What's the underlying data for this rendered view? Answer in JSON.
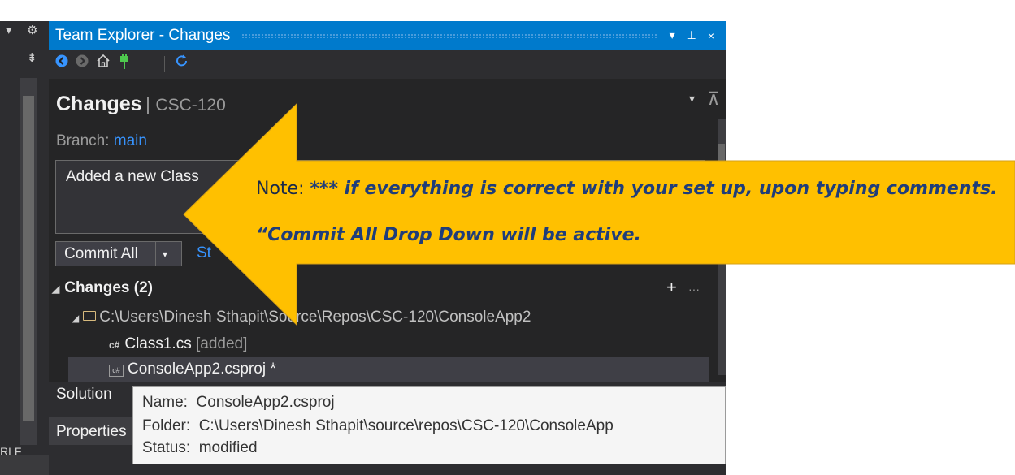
{
  "window": {
    "title": "Team Explorer - Changes",
    "title_buttons": [
      "▾",
      "⊥",
      "×"
    ]
  },
  "left_strip": {
    "line_ending": "RLF"
  },
  "toolbar": {
    "icons": [
      "back-icon",
      "forward-icon",
      "home-icon",
      "connect-icon",
      "refresh-icon"
    ]
  },
  "page": {
    "title": "Changes",
    "repo": "CSC-120",
    "branch_label": "Branch:",
    "branch_value": "main"
  },
  "comment": {
    "value": "Added a new Class"
  },
  "commit": {
    "label": "Commit All",
    "stash_label": "St"
  },
  "changes": {
    "header": "Changes (2)",
    "folder_path": "C:\\Users\\Dinesh Sthapit\\Source\\Repos\\CSC-120\\ConsoleApp2",
    "files": [
      {
        "name": "Class1.cs",
        "status": "[added]",
        "icon": "c#"
      },
      {
        "name": "ConsoleApp2.csproj *",
        "status": "",
        "icon": "c#"
      }
    ]
  },
  "tabs": {
    "solution": "Solution",
    "properties": "Properties"
  },
  "tooltip": {
    "name_label": "Name:",
    "name_value": "ConsoleApp2.csproj",
    "folder_label": "Folder:",
    "folder_value": "C:\\Users\\Dinesh Sthapit\\source\\repos\\CSC-120\\ConsoleApp",
    "status_label": "Status:",
    "status_value": "modified"
  },
  "annotation": {
    "prefix": "Note:",
    "line1": "*** if everything is correct with your set up, upon typing comments.",
    "line2": "“Commit All Drop Down will be active.",
    "fill_color": "#ffc000"
  },
  "colors": {
    "accent": "#007acc",
    "link": "#3794ff",
    "panel_bg": "#252526"
  }
}
